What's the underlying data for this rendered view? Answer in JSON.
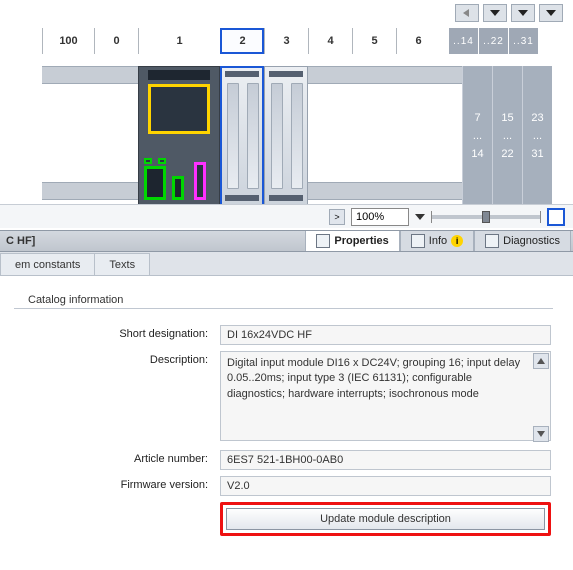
{
  "hw": {
    "slots": [
      "100",
      "0",
      "1",
      "2",
      "3",
      "4",
      "5",
      "6"
    ],
    "addr_cols": [
      "..14",
      "..22",
      "..31"
    ],
    "addr_ranges": [
      {
        "a": "7",
        "b": "...",
        "c": "14"
      },
      {
        "a": "15",
        "b": "...",
        "c": "22"
      },
      {
        "a": "23",
        "b": "...",
        "c": "31"
      }
    ],
    "zoom": "100%"
  },
  "titlebar": {
    "left_suffix": "C HF]",
    "tabs": {
      "properties": "Properties",
      "info": "Info",
      "diagnostics": "Diagnostics"
    }
  },
  "subtabs": {
    "em_constants": "em constants",
    "texts": "Texts"
  },
  "catalog": {
    "section": "Catalog information",
    "labels": {
      "short_designation": "Short designation:",
      "description": "Description:",
      "article_number": "Article number:",
      "firmware_version": "Firmware version:"
    },
    "short_designation": "DI 16x24VDC HF",
    "description": "Digital input module DI16 x DC24V; grouping 16; input delay 0.05..20ms; input type 3 (IEC 61131); configurable diagnostics; hardware interrupts; isochronous mode",
    "article_number": "6ES7 521-1BH00-0AB0",
    "firmware_version": "V2.0",
    "update_btn": "Update module description"
  }
}
